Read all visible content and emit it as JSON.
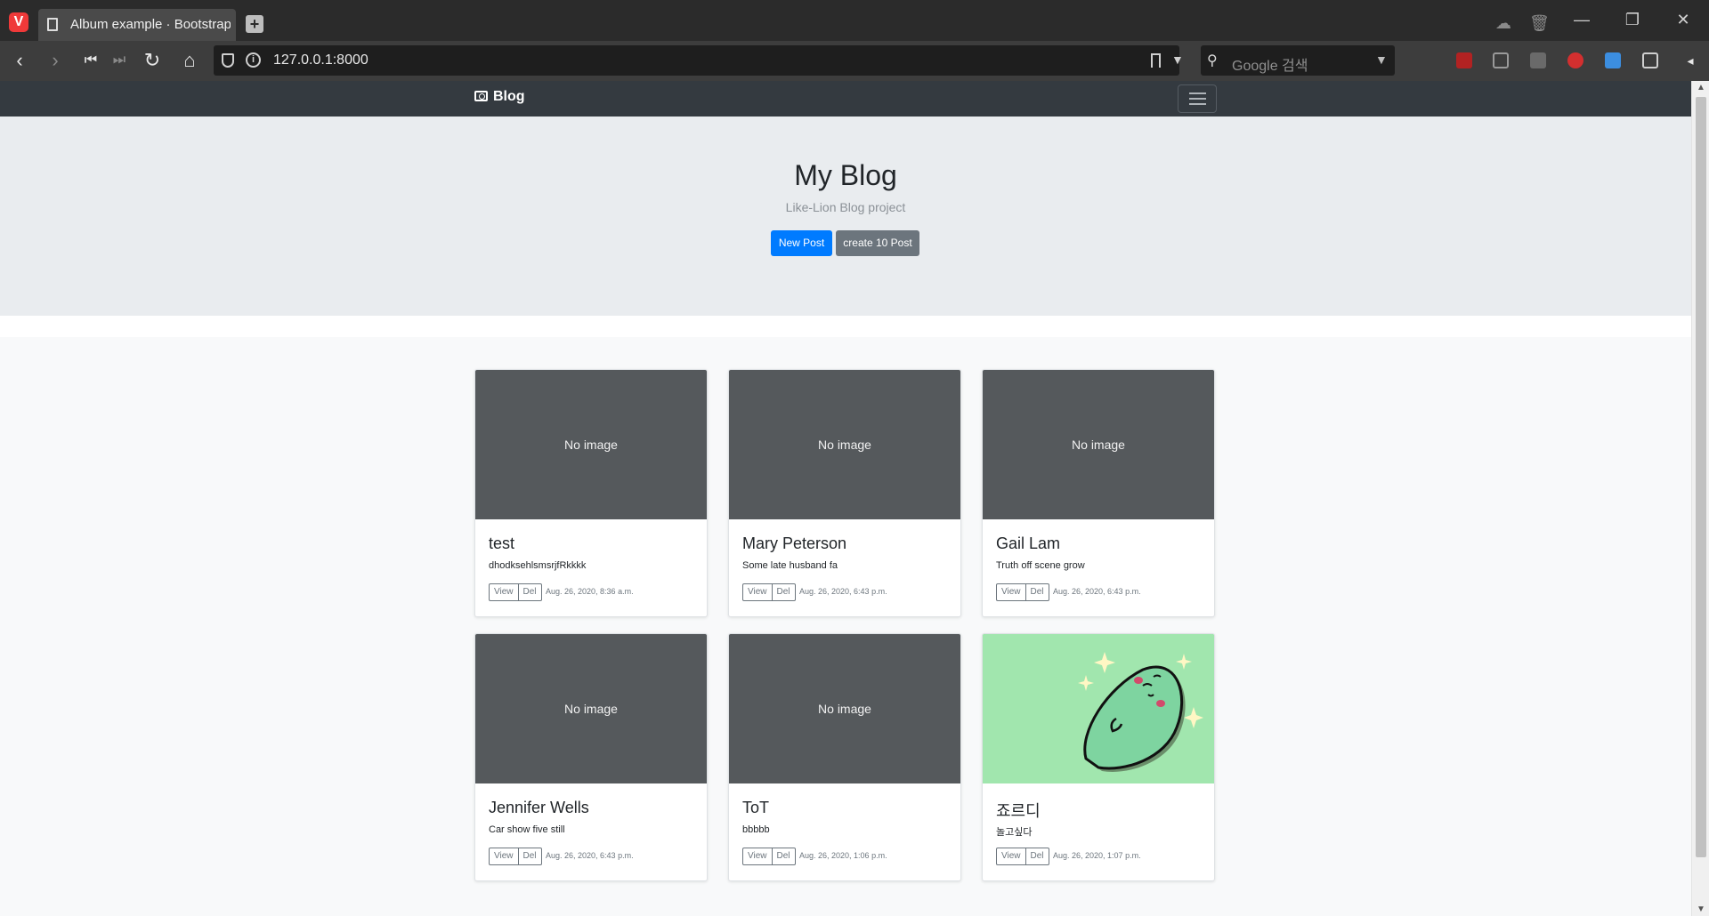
{
  "browser": {
    "tab_title": "Album example · Bootstrap",
    "url": "127.0.0.1:8000",
    "search_placeholder": "Google 검색"
  },
  "site": {
    "brand": "Blog"
  },
  "hero": {
    "title": "My Blog",
    "lead": "Like-Lion Blog project",
    "new_post_label": "New Post",
    "create_ten_label": "create 10 Post"
  },
  "posts": [
    {
      "thumb": "No image",
      "title": "test",
      "body": "dhodksehlsmsrjfRkkkk",
      "view": "View",
      "del": "Del",
      "date": "Aug. 26, 2020, 8:36 a.m."
    },
    {
      "thumb": "No image",
      "title": "Mary Peterson",
      "body": "Some late husband fa",
      "view": "View",
      "del": "Del",
      "date": "Aug. 26, 2020, 6:43 p.m."
    },
    {
      "thumb": "No image",
      "title": "Gail Lam",
      "body": "Truth off scene grow",
      "view": "View",
      "del": "Del",
      "date": "Aug. 26, 2020, 6:43 p.m."
    },
    {
      "thumb": "No image",
      "title": "Jennifer Wells",
      "body": "Car show five still",
      "view": "View",
      "del": "Del",
      "date": "Aug. 26, 2020, 6:43 p.m."
    },
    {
      "thumb": "No image",
      "title": "ToT",
      "body": "bbbbb",
      "view": "View",
      "del": "Del",
      "date": "Aug. 26, 2020, 1:06 p.m."
    },
    {
      "thumb": "",
      "title": "죠르디",
      "body": "놀고싶다",
      "view": "View",
      "del": "Del",
      "date": "Aug. 26, 2020, 1:07 p.m."
    }
  ],
  "colors": {
    "primary": "#007bff",
    "secondary": "#6c757d",
    "navbar": "#343a40",
    "jumbotron": "#e9ecef",
    "thumb_placeholder": "#55595c",
    "thumb_image_bg": "#a1e6ae"
  }
}
